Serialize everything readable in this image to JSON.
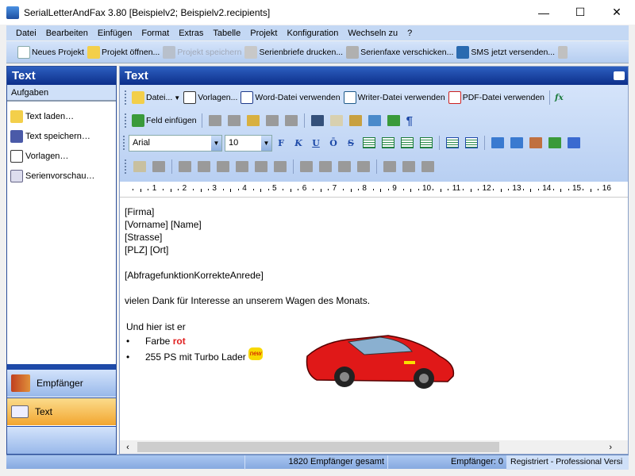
{
  "window": {
    "title": "SerialLetterAndFax 3.80 [Beispielv2; Beispielv2.recipients]",
    "minimize": "—",
    "maximize": "☐",
    "close": "✕"
  },
  "menu": [
    "Datei",
    "Bearbeiten",
    "Einfügen",
    "Format",
    "Extras",
    "Tabelle",
    "Projekt",
    "Konfiguration",
    "Wechseln zu",
    "?"
  ],
  "main_toolbar": {
    "new": "Neues Projekt",
    "open": "Projekt öffnen...",
    "save": "Projekt speichern",
    "print": "Serienbriefe drucken...",
    "fax": "Serienfaxe verschicken...",
    "sms": "SMS jetzt versenden..."
  },
  "left_panel": {
    "title": "Text",
    "section": "Aufgaben",
    "tasks": [
      "Text laden…",
      "Text speichern…",
      "Vorlagen…",
      "Serienvorschau…"
    ],
    "nav": {
      "recipients": "Empfänger",
      "text": "Text"
    }
  },
  "right_panel": {
    "title": "Text",
    "toolbar1": {
      "file": "Datei...",
      "templates": "Vorlagen...",
      "word": "Word-Datei verwenden",
      "writer": "Writer-Datei verwenden",
      "pdf": "PDF-Datei verwenden",
      "fx": "fx"
    },
    "toolbar2": {
      "insert_field": "Feld einfügen"
    },
    "format": {
      "font": "Arial",
      "size": "10",
      "bold": "F",
      "italic": "K",
      "underline": "U",
      "overline": "Ō",
      "strike": "S"
    },
    "ruler": [
      "1",
      "2",
      "3",
      "4",
      "5",
      "6",
      "7",
      "8",
      "9",
      "10",
      "11",
      "12",
      "13",
      "14",
      "15",
      "16"
    ]
  },
  "document": {
    "lines": [
      "[Firma]",
      "[Vorname] [Name]",
      "[Strasse]",
      "[PLZ] [Ort]",
      "",
      "[AbfragefunktionKorrekteAnrede]",
      "",
      "vielen Dank für Interesse an unserem Wagen des Monats."
    ],
    "intro": "Und hier ist er",
    "bullet1_prefix": "Farbe ",
    "bullet1_red": "rot",
    "bullet2": "255 PS mit Turbo Lader",
    "new_badge": "new"
  },
  "status": {
    "total": "1820 Empfänger gesamt",
    "recipients": "Empfänger: 0",
    "license": "Registriert - Professional Versi"
  },
  "colors": {
    "accent": "#0d2f8a",
    "active_nav": "#f2a630",
    "red_text": "#e02020"
  }
}
